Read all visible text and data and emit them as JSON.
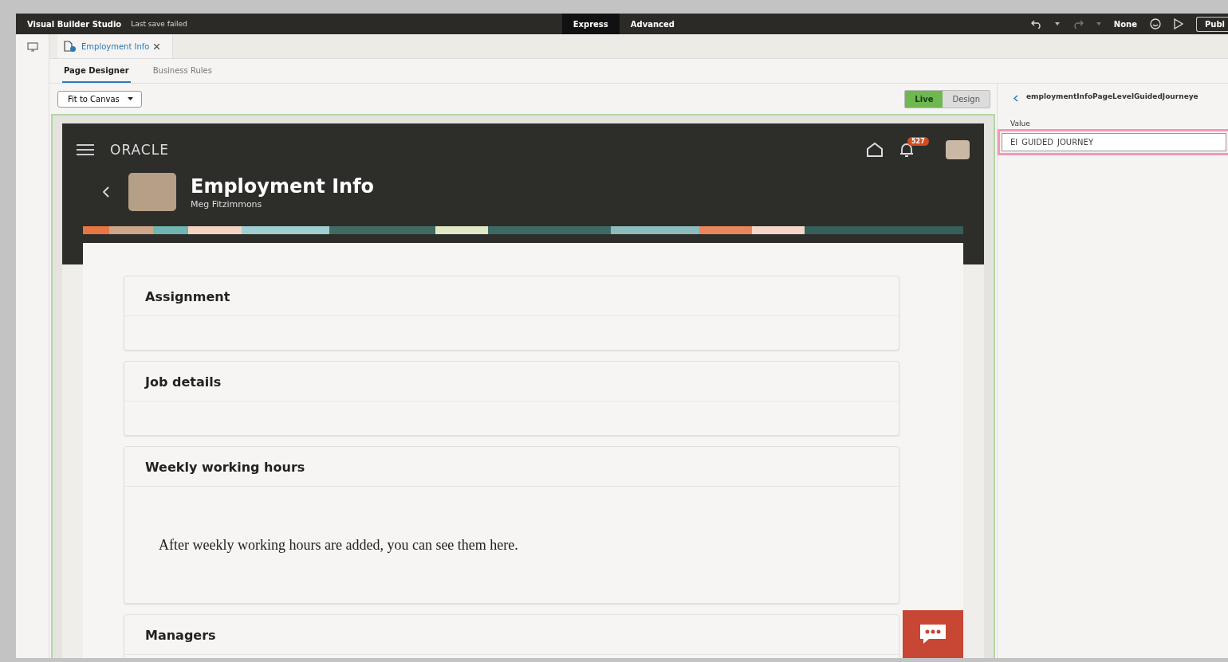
{
  "app": {
    "title": "Visual Builder Studio",
    "save_status": "Last save failed"
  },
  "modes": [
    {
      "label": "Express",
      "selected": true
    },
    {
      "label": "Advanced",
      "selected": false
    }
  ],
  "scope": "None",
  "publish": "Publ",
  "file_tabs": [
    {
      "label": "Employment Info",
      "selected": true
    }
  ],
  "editor_tabs": [
    {
      "label": "Page Designer",
      "selected": true
    },
    {
      "label": "Business Rules",
      "selected": false
    }
  ],
  "zoom_select": {
    "value": "Fit to Canvas"
  },
  "view_modes": [
    {
      "label": "Live",
      "selected": true
    },
    {
      "label": "Design",
      "selected": false
    }
  ],
  "properties": {
    "name": "employmentInfoPageLevelGuidedJourneye",
    "field_label": "Value",
    "value": "EI_GUIDED_JOURNEY"
  },
  "preview": {
    "logo": "ORACLE",
    "notification_count": "527",
    "page_title": "Employment Info",
    "person": "Meg Fitzimmons",
    "sections": [
      {
        "title": "Assignment"
      },
      {
        "title": "Job details"
      },
      {
        "title": "Weekly working hours",
        "message": "After weekly working hours are added, you can see them here."
      },
      {
        "title": "Managers"
      }
    ]
  }
}
